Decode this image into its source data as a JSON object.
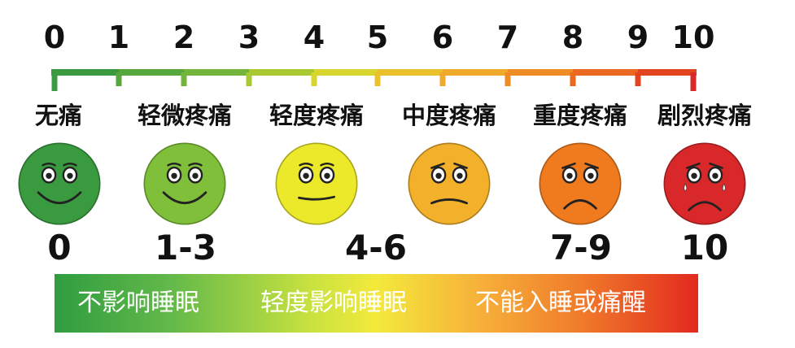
{
  "scale_numbers": [
    "0",
    "1",
    "2",
    "3",
    "4",
    "5",
    "6",
    "7",
    "8",
    "9",
    "10"
  ],
  "levels": [
    {
      "label": "无痛",
      "color": "#3a9a3f",
      "mouth": "smile"
    },
    {
      "label": "轻微疼痛",
      "color": "#7fbf3a",
      "mouth": "smile"
    },
    {
      "label": "轻度疼痛",
      "color": "#ece82a",
      "mouth": "flat"
    },
    {
      "label": "中度疼痛",
      "color": "#f2b02b",
      "mouth": "slight-frown"
    },
    {
      "label": "重度疼痛",
      "color": "#ef7b1e",
      "mouth": "frown"
    },
    {
      "label": "剧烈疼痛",
      "color": "#d9282a",
      "mouth": "cry"
    }
  ],
  "ranges": [
    "0",
    "1-3",
    "4-6",
    "7-9",
    "10"
  ],
  "sleep_bar": [
    "不影响睡眠",
    "轻度影响睡眠",
    "不能入睡或痛醒"
  ],
  "scale_colors": [
    "#3a9a3f",
    "#56a83c",
    "#72b53a",
    "#a9c832",
    "#d8d52e",
    "#ecc22c",
    "#f0aa2b",
    "#ef8c26",
    "#ea6a22",
    "#e2451f",
    "#d9282a"
  ]
}
